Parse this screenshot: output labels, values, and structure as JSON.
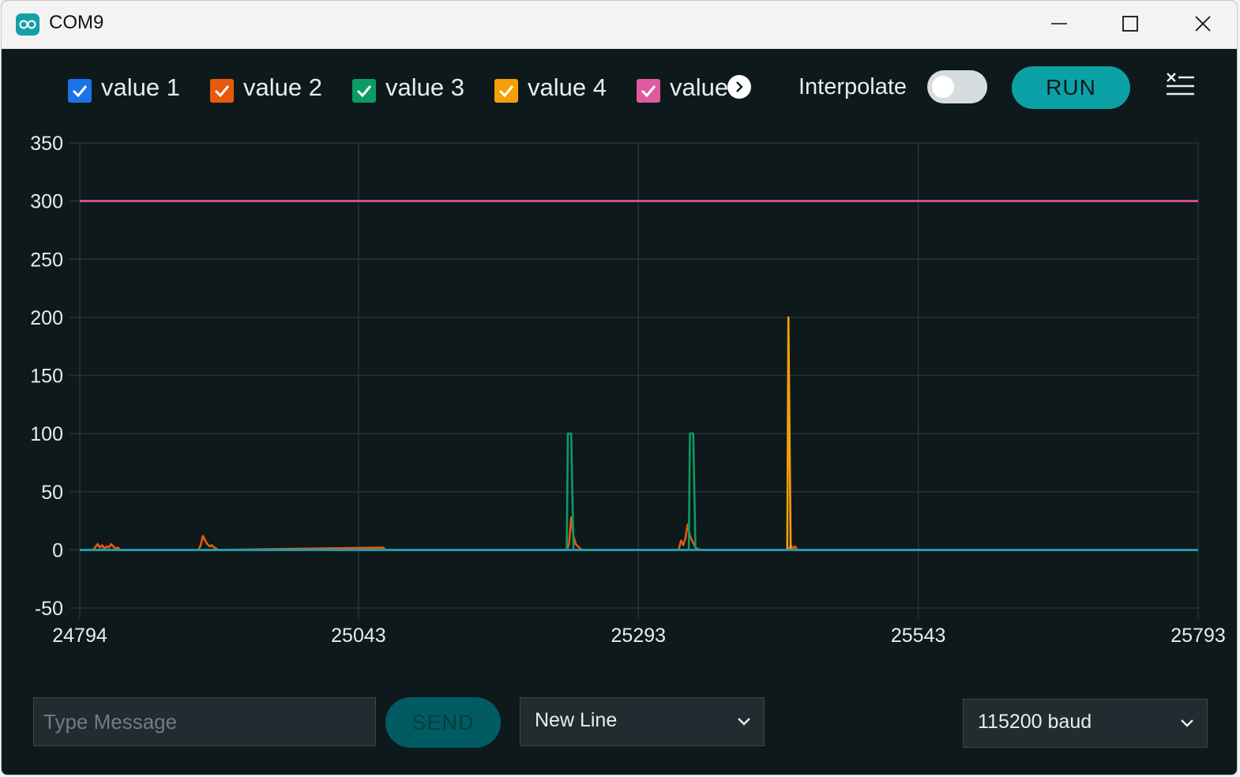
{
  "window": {
    "title": "COM9",
    "controls": [
      "minimize-icon",
      "maximize-icon",
      "close-icon"
    ]
  },
  "toolbar": {
    "legend": [
      {
        "label": "value 1",
        "color": "#1a73e8",
        "checked": true
      },
      {
        "label": "value 2",
        "color": "#e8590c",
        "checked": true
      },
      {
        "label": "value 3",
        "color": "#0c9b63",
        "checked": true
      },
      {
        "label": "value 4",
        "color": "#f5a00a",
        "checked": true
      },
      {
        "label": "value 5",
        "color": "#e05aa0",
        "checked": true
      }
    ],
    "interpolate_label": "Interpolate",
    "interpolate_on": false,
    "run_label": "RUN"
  },
  "chart_data": {
    "type": "line",
    "xlim": [
      24794,
      25793
    ],
    "ylim": [
      -50,
      350
    ],
    "x_ticks": [
      "24794",
      "25043",
      "25293",
      "25543",
      "25793"
    ],
    "y_ticks": [
      "350",
      "300",
      "250",
      "200",
      "150",
      "100",
      "50",
      "0",
      "-50"
    ],
    "grid": true,
    "series": [
      {
        "name": "value 2",
        "color": "#e8590c",
        "x": [
          24794,
          24806,
          24810,
          24812,
          24814,
          24816,
          24818,
          24820,
          24822,
          24824,
          24826,
          24828,
          24830,
          24832,
          24836,
          24900,
          24902,
          24904,
          24906,
          24908,
          24910,
          24912,
          24914,
          24918,
          25065,
          25067,
          25070,
          25229,
          25231,
          25233,
          25235,
          25237,
          25239,
          25241,
          25243,
          25250,
          25329,
          25331,
          25333,
          25335,
          25337,
          25339,
          25341,
          25343,
          25345,
          25349,
          25427,
          25429,
          25431,
          25433,
          25435,
          25793
        ],
        "y": [
          0,
          0,
          5,
          2,
          4,
          1,
          3,
          2,
          5,
          3,
          1,
          2,
          0,
          0,
          0,
          0,
          4,
          12,
          8,
          5,
          3,
          4,
          2,
          0,
          2,
          0,
          0,
          0,
          5,
          28,
          12,
          5,
          3,
          1,
          0,
          0,
          0,
          8,
          4,
          10,
          22,
          12,
          8,
          4,
          1,
          0,
          0,
          4,
          1,
          3,
          0,
          0
        ]
      },
      {
        "name": "value 3",
        "color": "#0c9b63",
        "x": [
          24794,
          25227,
          25229,
          25230,
          25232,
          25233,
          25235,
          25336,
          25338,
          25339,
          25341,
          25342,
          25344,
          25793
        ],
        "y": [
          0,
          0,
          0,
          100,
          100,
          100,
          0,
          0,
          0,
          100,
          100,
          100,
          0,
          0
        ]
      },
      {
        "name": "value 4",
        "color": "#f5a00a",
        "x": [
          24794,
          25424,
          25426,
          25427,
          25429,
          25793
        ],
        "y": [
          0,
          0,
          0,
          200,
          0,
          0
        ]
      },
      {
        "name": "value 5",
        "color": "#e05aa0",
        "x": [
          24794,
          25793
        ],
        "y": [
          300,
          300
        ]
      },
      {
        "name": "value 1",
        "color": "#1a73e8",
        "x": [
          24794,
          25793
        ],
        "y": [
          0,
          0
        ]
      }
    ]
  },
  "bottom_bar": {
    "message_placeholder": "Type Message",
    "send_label": "SEND",
    "line_ending": "New Line",
    "baud_rate": "115200 baud"
  }
}
